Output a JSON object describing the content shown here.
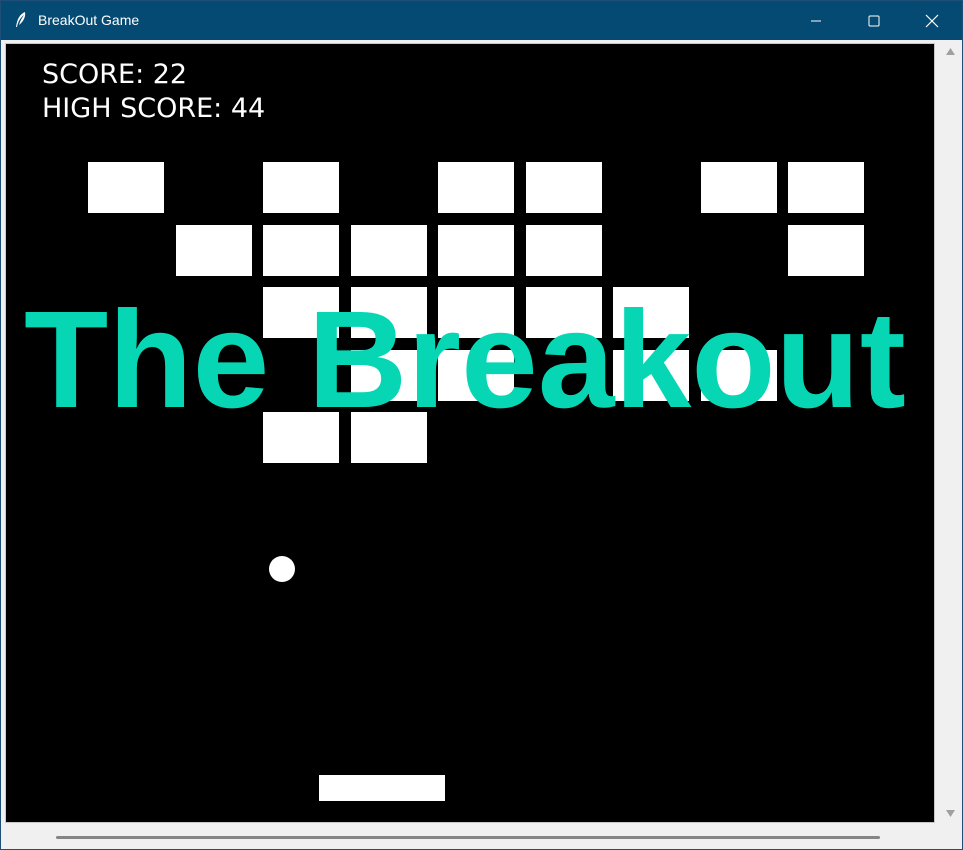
{
  "window": {
    "title": "BreakOut Game",
    "titlebar_color": "#044a73",
    "icons": {
      "app": "feather-icon",
      "minimize": "minimize-icon",
      "maximize": "maximize-icon",
      "close": "close-icon"
    }
  },
  "game": {
    "score": "SCORE: 22",
    "high_score": "HIGH SCORE: 44",
    "title_overlay": "The Breakout",
    "background_color": "#000000",
    "brick_color": "#ffffff",
    "title_color": "#06d6b4",
    "ball_color": "#ffffff",
    "paddle_color": "#ffffff",
    "bricks_grid": [
      [
        1,
        0,
        1,
        0,
        1,
        1,
        0,
        1,
        1
      ],
      [
        0,
        1,
        1,
        1,
        1,
        1,
        0,
        0,
        1
      ],
      [
        0,
        0,
        1,
        1,
        1,
        1,
        1,
        0,
        0
      ],
      [
        0,
        0,
        0,
        1,
        1,
        0,
        1,
        1,
        0
      ],
      [
        0,
        0,
        1,
        1,
        0,
        0,
        0,
        0,
        0
      ]
    ]
  },
  "scrollbars": {
    "vertical": {
      "up_icon": "arrow-up-icon",
      "down_icon": "arrow-down-icon"
    },
    "horizontal": {
      "thumb": "scroll-thumb"
    }
  }
}
